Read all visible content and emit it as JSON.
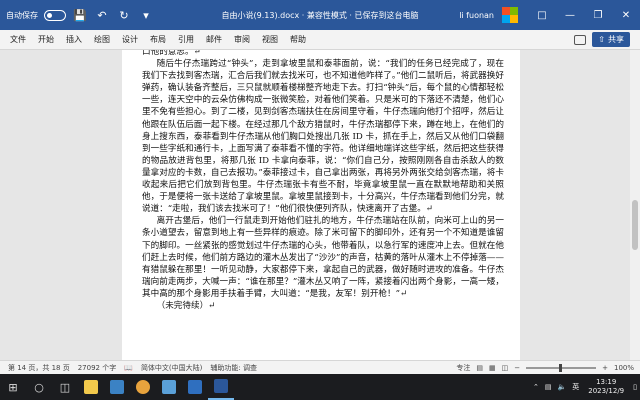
{
  "titlebar": {
    "autosave_label": "自动保存",
    "autosave_state": "关",
    "document_title": "自由小说(9.13).docx  ·  兼容性模式 · 已保存到这台电脑",
    "user_name": "li fuonan",
    "colors": {
      "bar": "#2b579a"
    }
  },
  "ribbon": {
    "tabs": [
      "文件",
      "开始",
      "插入",
      "绘图",
      "设计",
      "布局",
      "引用",
      "邮件",
      "审阅",
      "视图",
      "帮助"
    ],
    "share_label": "共享"
  },
  "document": {
    "paragraphs": [
      "口他的意思。↵",
      "随后牛仔杰瑞跨过“钟头”，走到拿坡里鼠和泰菲面前，说：“我们的任务已经完成了，现在我们下去找到客杰瑞，汇合后我们就去找米可，也不知道他咋样了。”他们二鼠听后，将武器换好弹药，确认装备齐整后，三只鼠就顺着楼梯整齐地走下去。打扫“钟头”后，每个鼠的心情都轻松一些，连天空中的云朵仿佛构成一张微笑脸，对着他们笑着。只是米可的下落还不清楚，他们心里不免有些担心。到了二楼，见到剑客杰瑞扶住在房间里守着，牛仔杰瑞向他打个招呼，然后让他跟在队伍后面一起下楼。在经过那几个敌方猎鼠时，牛仔杰瑞都停下来，蹲在地上，在他们的身上搜东西，泰菲看到牛仔杰瑞从他们胸口处搜出几张 ID 卡，抓在手上，然后又从他们口袋翻到一些字纸和通行卡，上面写满了泰菲看不懂的字符。他详细地端详这些字纸，然后把这些获得的物品放进背包里，将那几张 ID 卡拿向泰菲，说：“你们自己分，按照刚刚各自击杀敌人的数量拿对应的卡数，自己去报功。”泰菲接过卡，自己拿出两张，再将另外两张交给剑客杰瑞，将卡收起来后把它们放到背包里。牛仔杰瑞张卡有些不耐，毕竟拿坡里鼠一直在默默地帮助和关照他，于是便将一张卡送给了拿坡里鼠。拿坡里鼠接到卡，十分高兴，牛仔杰瑞看到他们分完，就说道：“走啦，我们该去找米可了！”他们很快便列齐队，快速离开了古堡。↵",
      "离开古堡后，他们一行鼠走到开始他们驻扎的地方，牛仔杰瑞站在队前，向米可上山的另一条小道望去，留意到地上有一些异样的痕迹。除了米可留下的脚印外，还有另一个不知道是谁留下的脚印。一丝紧张的感觉划过牛仔杰瑞的心头，他带着队，以急行军的速度冲上去。但就在他们赶上去时候，他们前方路边的灌木丛发出了“沙沙”的声音，枯黄的落叶从灌木上不停掉落——有猎鼠躲在那里！一听见动静，大家都停下来，拿起自己的武器，做好随时进攻的准备。牛仔杰瑞向前走两步，大喊一声：“谁在那里？”灌木丛又响了一阵，紧接着闪出两个身影，一高一矮，其中高的那个身影用手扶着手臂，大叫道：“是我，友军！别开枪！”↵",
      "（未完待续）↵"
    ]
  },
  "status": {
    "page": "第 14 页，共 18 页",
    "words": "27092 个字",
    "language": "简体中文(中国大陆)",
    "accessibility": "辅助功能: 调查",
    "focus_label": "专注",
    "zoom": "100%",
    "zoom_fraction": 0.5
  },
  "taskbar": {
    "ime": "英",
    "time": "13:19",
    "date": "2023/12/9",
    "apps": [
      {
        "name": "chrome",
        "color": "#e8a33d"
      },
      {
        "name": "word",
        "color": "#2b579a"
      }
    ]
  }
}
